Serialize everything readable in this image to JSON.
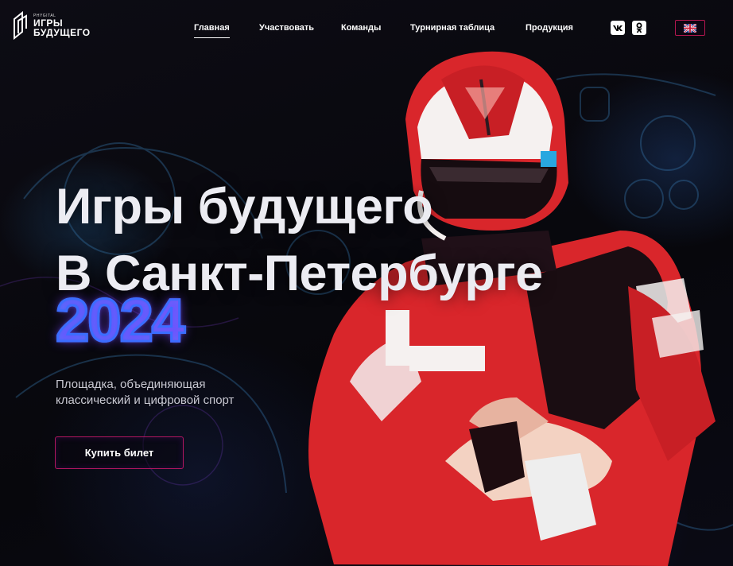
{
  "header": {
    "logo": {
      "small": "PHYGITAL",
      "line1": "ИГРЫ",
      "line2": "БУДУЩЕГО"
    },
    "nav": [
      {
        "label": "Главная",
        "active": true
      },
      {
        "label": "Участвовать",
        "active": false
      },
      {
        "label": "Команды",
        "active": false
      },
      {
        "label": "Турнирная таблица",
        "active": false
      },
      {
        "label": "Продукция",
        "active": false
      }
    ],
    "social": [
      {
        "name": "vk-icon",
        "glyph": "vk"
      },
      {
        "name": "odnoklassniki-icon",
        "glyph": "ok"
      }
    ],
    "language_icon": "uk-flag-icon"
  },
  "hero": {
    "title_line1": "Игры будущего",
    "title_line2": "В Санкт-Петербурге",
    "year": "2024",
    "subtitle_line1": "Площадка, объединяющая",
    "subtitle_line2": "классический и цифровой спорт",
    "cta_label": "Купить билет"
  },
  "colors": {
    "accent_border": "#b0165e",
    "year_gradient_start": "#1d7bd6",
    "year_gradient_end": "#b33bd6",
    "background": "#0b0a10",
    "racer_red": "#e3262b"
  }
}
